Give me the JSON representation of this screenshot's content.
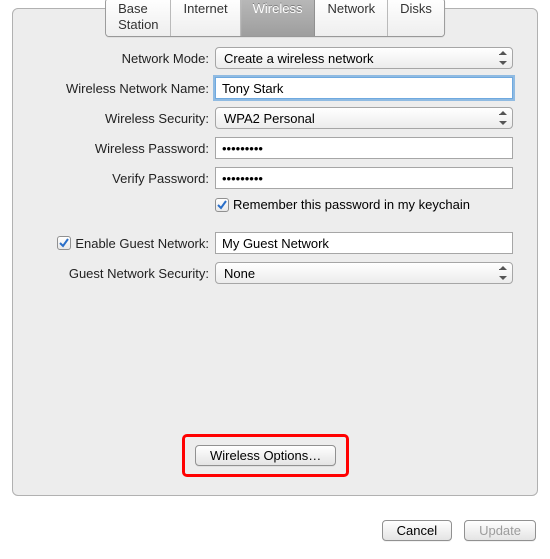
{
  "tabs": {
    "base_station": "Base Station",
    "internet": "Internet",
    "wireless": "Wireless",
    "network": "Network",
    "disks": "Disks",
    "selected": "wireless"
  },
  "labels": {
    "network_mode": "Network Mode:",
    "wireless_name": "Wireless Network Name:",
    "wireless_security": "Wireless Security:",
    "wireless_password": "Wireless Password:",
    "verify_password": "Verify Password:",
    "remember_keychain": "Remember this password in my keychain",
    "enable_guest": "Enable Guest Network:",
    "guest_security": "Guest Network Security:"
  },
  "values": {
    "network_mode": "Create a wireless network",
    "wireless_name": "Tony Stark",
    "wireless_security": "WPA2 Personal",
    "wireless_password": "•••••••••",
    "verify_password": "•••••••••",
    "remember_keychain_checked": true,
    "enable_guest_checked": true,
    "guest_name": "My Guest Network",
    "guest_security": "None"
  },
  "buttons": {
    "wireless_options": "Wireless Options…",
    "cancel": "Cancel",
    "update": "Update"
  }
}
